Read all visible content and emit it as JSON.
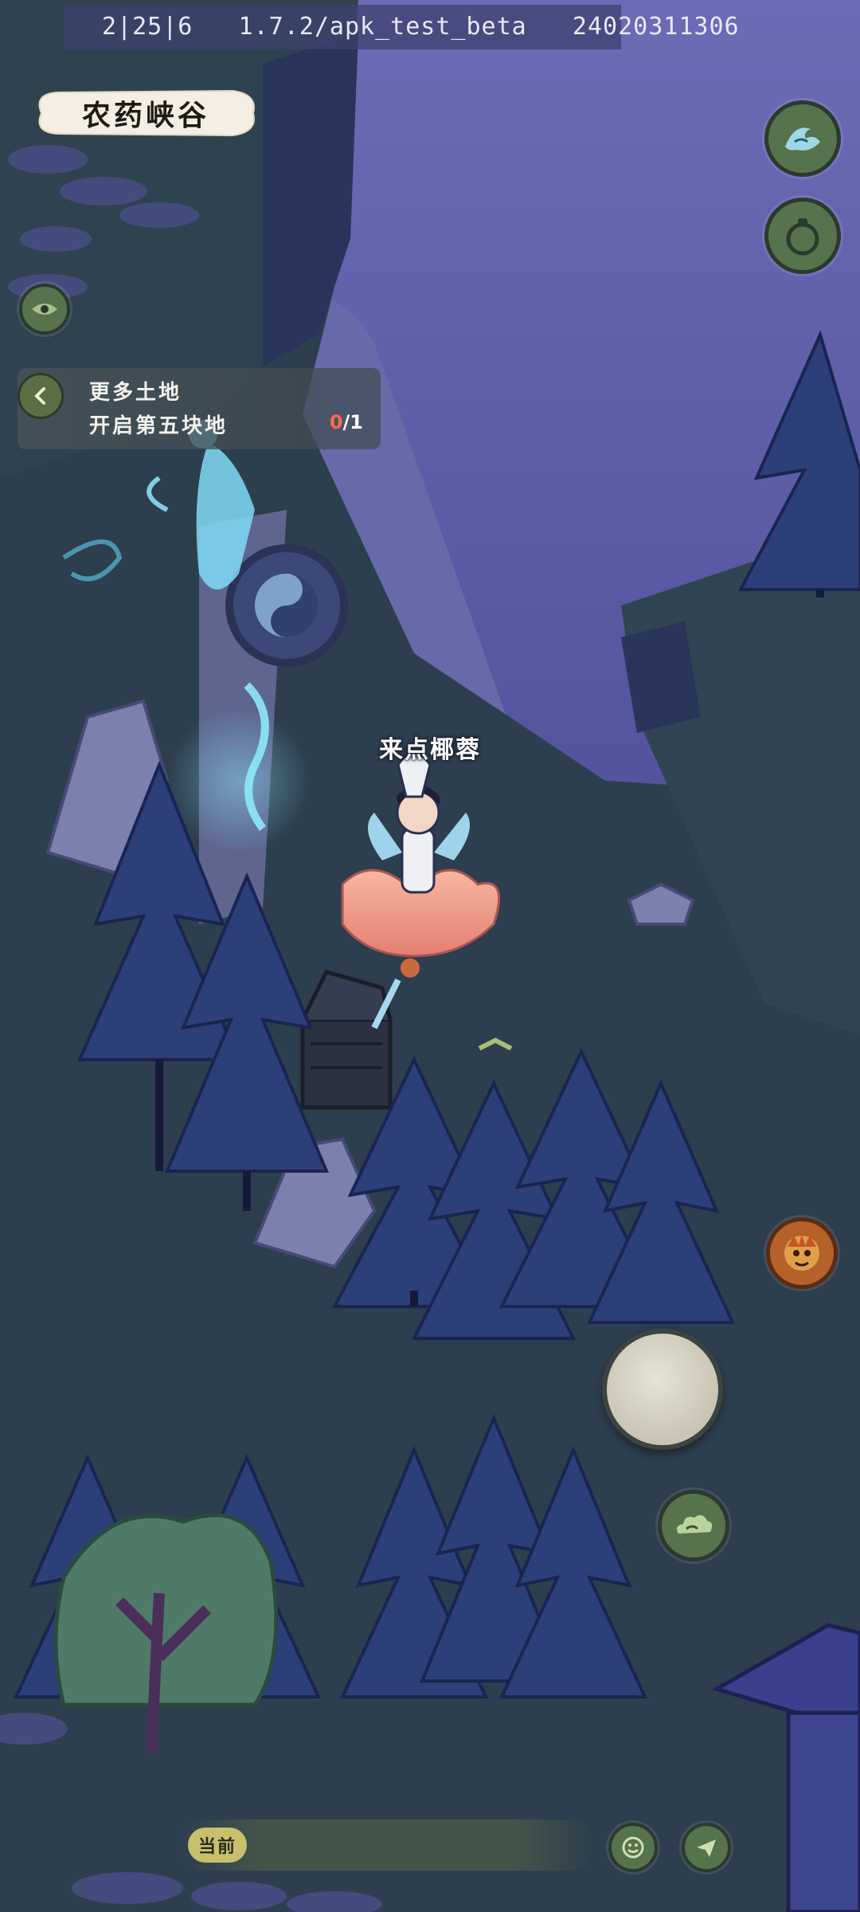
{
  "debug": {
    "build": "2|25|6   1.7.2/apk_test_beta   24020311306"
  },
  "location": {
    "name": "农药峡谷"
  },
  "quest": {
    "title": "更多土地",
    "description": "开启第五块地",
    "progress_current": "0",
    "progress_total": "/1"
  },
  "player": {
    "name": "来点椰蓉"
  },
  "chat": {
    "channel_tag": "当前"
  },
  "icons": {
    "top_right": [
      "wave-icon",
      "gourd-icon"
    ],
    "side": [
      "eye-icon",
      "back-arrow-icon"
    ],
    "bottom_right": [
      "boss-portrait-icon",
      "cloud-icon",
      "emoji-icon",
      "send-icon"
    ]
  },
  "colors": {
    "button_green": "#56734e",
    "progress_red": "#ff6b4a",
    "night_sky": "#5a5aa6",
    "grass": "#2d3e4e"
  }
}
